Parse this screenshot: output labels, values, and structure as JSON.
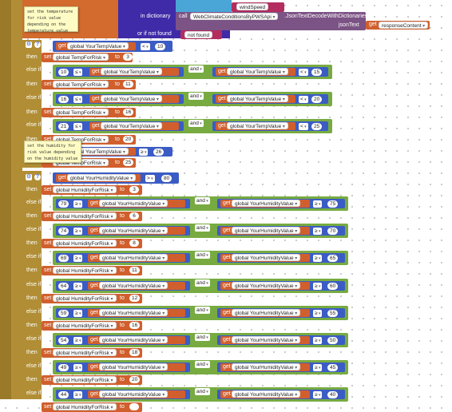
{
  "top": {
    "dictionary_key": "windSpeed",
    "in_dictionary_label": "in dictionary",
    "call_label": "call",
    "component": "WebClimateConditionsByPWSApi",
    "method": ".JsonTextDecodeWithDictionaries",
    "json_text_label": "jsonText",
    "get_label": "get",
    "response_var": "responseContent",
    "or_if_not_found_label": "or if not found",
    "not_found_value": "not found"
  },
  "comments": {
    "temp_note": "set the temperature for risk value depending on the temperature value",
    "humidity_note": "set the humidity for risk value depending on the humidity value"
  },
  "labels": {
    "if": "if",
    "then": "then",
    "else_if": "else if",
    "set": "set",
    "to": "to",
    "get": "get",
    "and": "and"
  },
  "temp_block": {
    "first_condition": {
      "var": "global YourTempValue",
      "op": "<",
      "value": "10"
    },
    "then_var": "global TempForRisk",
    "branches": [
      {
        "low": "10",
        "op_low": "≤",
        "var": "global YourTempValue",
        "op_high": "<",
        "high": "15",
        "risk": "11"
      },
      {
        "low": "16",
        "op_low": "≤",
        "var": "global YourTempValue",
        "op_high": "<",
        "high": "20",
        "risk": "16"
      },
      {
        "low": "21",
        "op_low": "≤",
        "var": "global YourTempValue",
        "op_high": "<",
        "high": "25",
        "risk": "20"
      }
    ],
    "first_risk": "3",
    "last_partial": {
      "var": "global YourTempValue",
      "op": "≥",
      "value": "26",
      "risk": "25"
    }
  },
  "humidity_block": {
    "first_condition": {
      "var": "global YourHumidityValue",
      "op": ">",
      "value": "80"
    },
    "then_var": "global HumidityForRisk",
    "first_risk": "3",
    "branches": [
      {
        "low": "79",
        "var": "global YourHumidityValue",
        "high": "75",
        "risk": "6"
      },
      {
        "low": "74",
        "var": "global YourHumidityValue",
        "high": "70",
        "risk": "8"
      },
      {
        "low": "69",
        "var": "global YourHumidityValue",
        "high": "65",
        "risk": "11"
      },
      {
        "low": "64",
        "var": "global YourHumidityValue",
        "high": "60",
        "risk": "12"
      },
      {
        "low": "59",
        "var": "global YourHumidityValue",
        "high": "55",
        "risk": "16"
      },
      {
        "low": "54",
        "var": "global YourHumidityValue",
        "high": "50",
        "risk": "18"
      },
      {
        "low": "49",
        "var": "global YourHumidityValue",
        "high": "45",
        "risk": "20"
      },
      {
        "low": "44",
        "var": "global YourHumidityValue",
        "high": "40",
        "risk": ""
      }
    ],
    "op_low": "≥",
    "op_high": "≥"
  },
  "colors": {
    "control": "#b18e35",
    "math": "#3b5cc4",
    "logic": "#77ab41",
    "variable": "#d05f2d",
    "dictionary": "#3f2aa8",
    "component": "#7c5385",
    "text": "#b32d5e"
  }
}
